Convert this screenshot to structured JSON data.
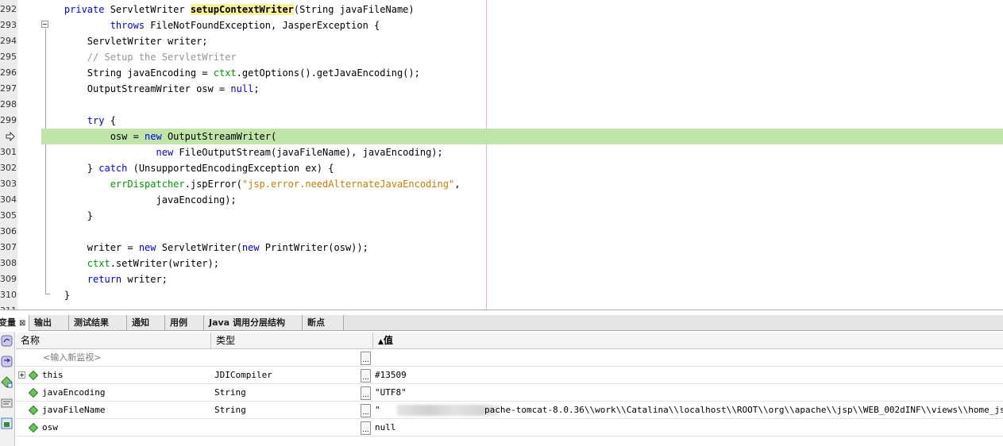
{
  "editor": {
    "lines": [
      {
        "num": "292",
        "segments": [
          {
            "t": "    "
          },
          {
            "t": "private",
            "c": "kw"
          },
          {
            "t": " ServletWriter "
          },
          {
            "t": "setupContextWriter",
            "c": "hl"
          },
          {
            "t": "(String javaFileName)"
          }
        ]
      },
      {
        "num": "293",
        "segments": [
          {
            "t": "            "
          },
          {
            "t": "throws",
            "c": "kw"
          },
          {
            "t": " FileNotFoundException, JasperException {"
          }
        ]
      },
      {
        "num": "294",
        "segments": [
          {
            "t": "        ServletWriter writer;"
          }
        ]
      },
      {
        "num": "295",
        "segments": [
          {
            "t": "        "
          },
          {
            "t": "// Setup the ServletWriter",
            "c": "cm"
          }
        ]
      },
      {
        "num": "296",
        "segments": [
          {
            "t": "        String javaEncoding = "
          },
          {
            "t": "ctxt",
            "c": "fld"
          },
          {
            "t": ".getOptions().getJavaEncoding();"
          }
        ]
      },
      {
        "num": "297",
        "segments": [
          {
            "t": "        OutputStreamWriter osw = "
          },
          {
            "t": "null",
            "c": "kw"
          },
          {
            "t": ";"
          }
        ]
      },
      {
        "num": "298",
        "segments": []
      },
      {
        "num": "299",
        "segments": [
          {
            "t": "        "
          },
          {
            "t": "try",
            "c": "kw"
          },
          {
            "t": " {"
          }
        ]
      },
      {
        "num": "",
        "current": true,
        "segments": [
          {
            "t": "            osw = "
          },
          {
            "t": "new",
            "c": "kw"
          },
          {
            "t": " OutputStreamWriter("
          }
        ]
      },
      {
        "num": "301",
        "segments": [
          {
            "t": "                    "
          },
          {
            "t": "new",
            "c": "kw"
          },
          {
            "t": " FileOutputStream(javaFileName), javaEncoding);"
          }
        ]
      },
      {
        "num": "302",
        "segments": [
          {
            "t": "        } "
          },
          {
            "t": "catch",
            "c": "kw"
          },
          {
            "t": " (UnsupportedEncodingException ex) {"
          }
        ]
      },
      {
        "num": "303",
        "segments": [
          {
            "t": "            "
          },
          {
            "t": "errDispatcher",
            "c": "fld"
          },
          {
            "t": ".jspError("
          },
          {
            "t": "\"jsp.error.needAlternateJavaEncoding\"",
            "c": "str"
          },
          {
            "t": ","
          }
        ]
      },
      {
        "num": "304",
        "segments": [
          {
            "t": "                    javaEncoding);"
          }
        ]
      },
      {
        "num": "305",
        "segments": [
          {
            "t": "        }"
          }
        ]
      },
      {
        "num": "306",
        "segments": []
      },
      {
        "num": "307",
        "segments": [
          {
            "t": "        writer = "
          },
          {
            "t": "new",
            "c": "kw"
          },
          {
            "t": " ServletWriter("
          },
          {
            "t": "new",
            "c": "kw"
          },
          {
            "t": " PrintWriter(osw));"
          }
        ]
      },
      {
        "num": "308",
        "segments": [
          {
            "t": "        "
          },
          {
            "t": "ctxt",
            "c": "fld"
          },
          {
            "t": ".setWriter(writer);"
          }
        ]
      },
      {
        "num": "309",
        "segments": [
          {
            "t": "        "
          },
          {
            "t": "return",
            "c": "kw"
          },
          {
            "t": " writer;"
          }
        ]
      },
      {
        "num": "310",
        "segments": [
          {
            "t": "    }"
          }
        ]
      },
      {
        "num": "311",
        "segments": []
      }
    ],
    "colors": {
      "keyword": "#0000e6",
      "comment": "#969696",
      "string": "#ce7b00",
      "field": "#009900",
      "current_line": "#bfe5a8",
      "highlight": "#f7f29a"
    }
  },
  "tabs": [
    {
      "label": "变量",
      "close": "⊠",
      "active": true
    },
    {
      "label": "输出"
    },
    {
      "label": "测试结果"
    },
    {
      "label": "通知"
    },
    {
      "label": "用例"
    },
    {
      "label": "Java 调用分层结构"
    },
    {
      "label": "断点"
    }
  ],
  "variables": {
    "headers": {
      "name": "名称",
      "type": "类型",
      "value": "值",
      "sort_indicator": "▲"
    },
    "watch_placeholder": "<输入新监视>",
    "ellipsis": "...",
    "rows": [
      {
        "name": "this",
        "type": "JDICompiler",
        "value": "#13509",
        "expandable": true
      },
      {
        "name": "javaEncoding",
        "type": "String",
        "value": "\"UTF8\""
      },
      {
        "name": "javaFileName",
        "type": "String",
        "value_prefix": "\"",
        "value": "pache-tomcat-8.0.36\\\\work\\\\Catalina\\\\localhost\\\\ROOT\\\\org\\\\apache\\\\jsp\\\\WEB_002dINF\\\\views\\\\home_jsp.java\"",
        "redacted": true
      },
      {
        "name": "osw",
        "type": "",
        "value": "null"
      }
    ]
  }
}
